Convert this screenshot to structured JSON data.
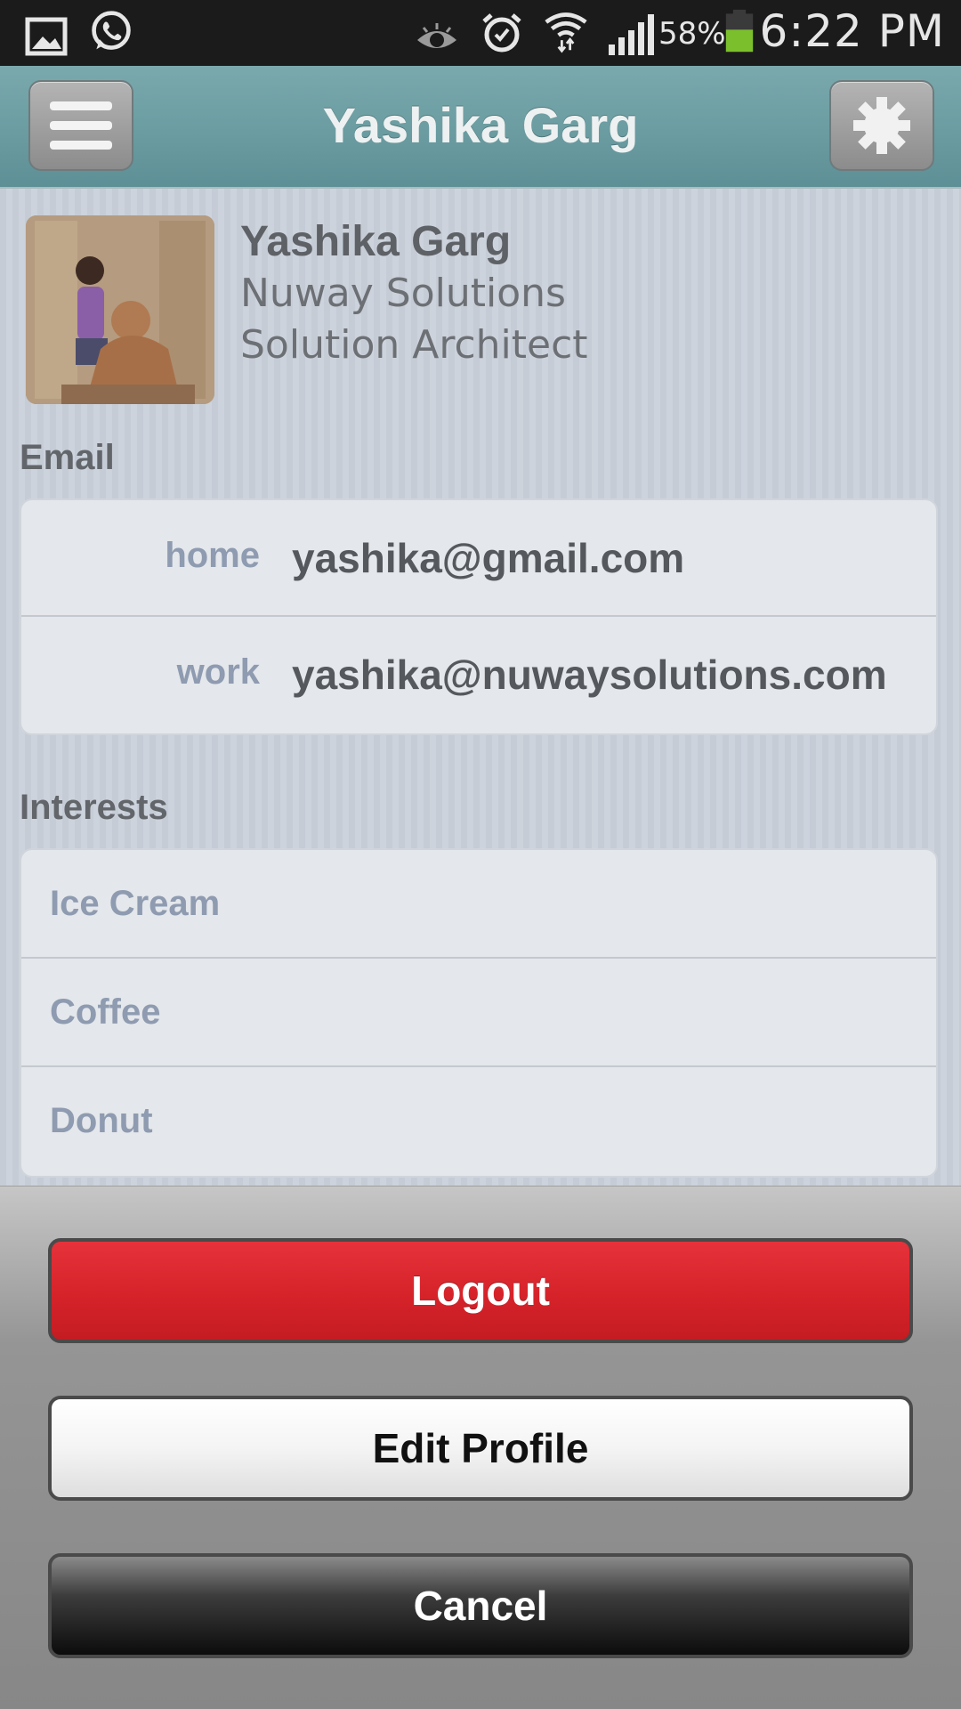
{
  "status_bar": {
    "time": "6:22 PM",
    "battery_percent": "58%",
    "battery_level": 0.58,
    "icons": [
      "gallery-icon",
      "whatsapp-icon",
      "eye-icon",
      "alarm-icon",
      "wifi-icon",
      "signal-icon",
      "battery-icon"
    ],
    "battery_color": "#7bc02c"
  },
  "header": {
    "title": "Yashika Garg",
    "menu_icon": "hamburger-menu-icon",
    "settings_icon": "gear-icon"
  },
  "profile": {
    "name": "Yashika Garg",
    "company": "Nuway Solutions",
    "role": "Solution Architect",
    "avatar": "profile-photo"
  },
  "email": {
    "section_title": "Email",
    "rows": [
      {
        "label": "home",
        "value": "yashika@gmail.com"
      },
      {
        "label": "work",
        "value": "yashika@nuwaysolutions.com"
      }
    ]
  },
  "interests": {
    "section_title": "Interests",
    "items": [
      "Ice Cream",
      "Coffee",
      "Donut"
    ]
  },
  "actions": {
    "logout": "Logout",
    "edit_profile": "Edit Profile",
    "cancel": "Cancel"
  },
  "colors": {
    "header": "#6a9ca1",
    "logout": "#d6232a",
    "label": "#8e9bb0"
  }
}
